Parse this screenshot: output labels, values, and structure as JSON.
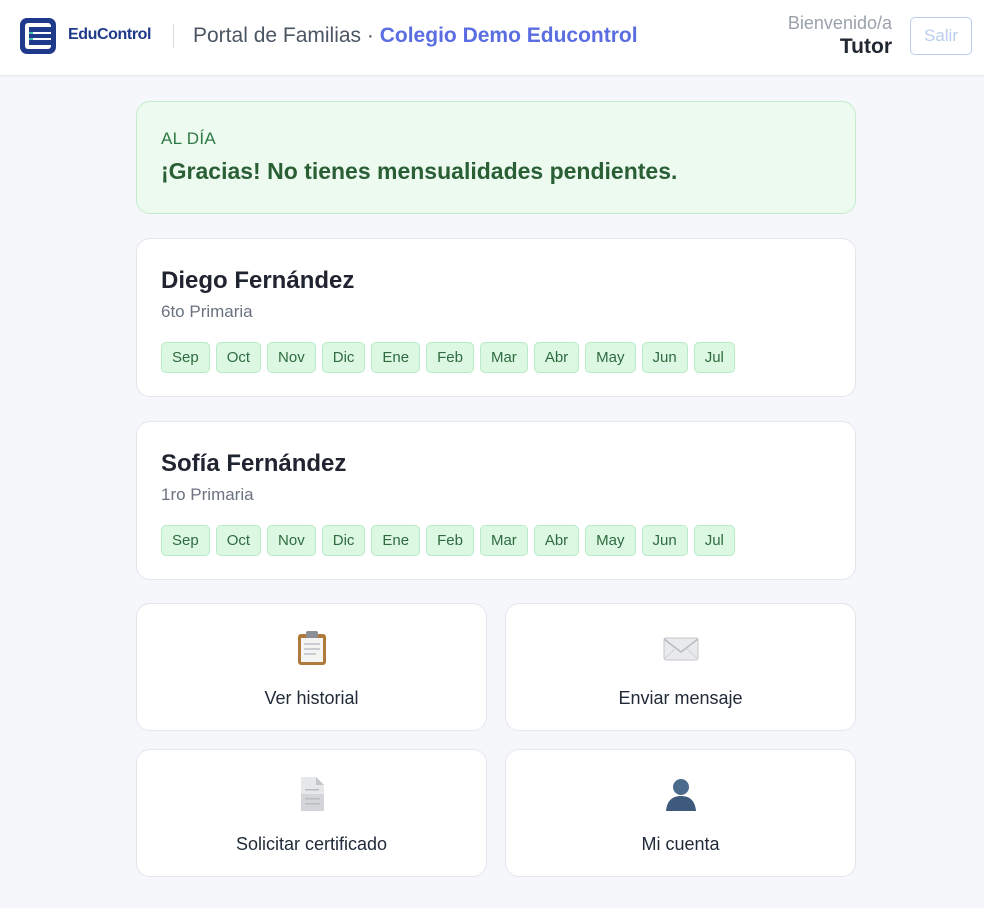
{
  "header": {
    "logo_text": "EduControl",
    "portal_label": "Portal de Familias",
    "separator": " · ",
    "school_name": "Colegio Demo Educontrol",
    "welcome_label": "Bienvenido/a",
    "user_role": "Tutor",
    "logout_label": "Salir"
  },
  "status": {
    "tag": "AL DÍA",
    "message": "¡Gracias! No tienes mensualidades pendientes."
  },
  "students": [
    {
      "name": "Diego Fernández",
      "grade": "6to Primaria",
      "months": [
        "Sep",
        "Oct",
        "Nov",
        "Dic",
        "Ene",
        "Feb",
        "Mar",
        "Abr",
        "May",
        "Jun",
        "Jul"
      ]
    },
    {
      "name": "Sofía Fernández",
      "grade": "1ro Primaria",
      "months": [
        "Sep",
        "Oct",
        "Nov",
        "Dic",
        "Ene",
        "Feb",
        "Mar",
        "Abr",
        "May",
        "Jun",
        "Jul"
      ]
    }
  ],
  "actions": [
    {
      "label": "Ver historial",
      "icon": "clipboard-icon"
    },
    {
      "label": "Enviar mensaje",
      "icon": "envelope-icon"
    },
    {
      "label": "Solicitar certificado",
      "icon": "document-icon"
    },
    {
      "label": "Mi cuenta",
      "icon": "user-icon"
    }
  ],
  "colors": {
    "brand": "#1f3a8a",
    "accent": "#5b6ee1",
    "paid_bg": "#dcf8e3",
    "paid_text": "#2f6b3f",
    "status_bg": "#ecfaef"
  }
}
